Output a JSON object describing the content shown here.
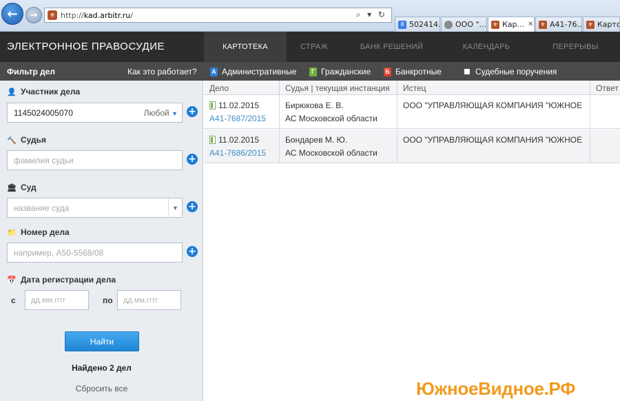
{
  "browser": {
    "url_prefix": "http://",
    "url_host": "kad.arbitr.ru",
    "url_suffix": "/",
    "address_controls": "⌕ ▾ ↻",
    "tabs": [
      {
        "label": "502414...",
        "icon": "google-icon",
        "color": "#3b7de8",
        "active": false,
        "closable": false
      },
      {
        "label": "ООО \"...",
        "icon": "loading-icon",
        "color": "#8a8a8a",
        "active": false,
        "closable": false
      },
      {
        "label": "Кар...",
        "icon": "emblem-icon",
        "color": "#b5522b",
        "active": true,
        "closable": true
      },
      {
        "label": "А41-76...",
        "icon": "emblem-icon",
        "color": "#b5522b",
        "active": false,
        "closable": false
      },
      {
        "label": "Картоте...",
        "icon": "emblem-icon",
        "color": "#b5522b",
        "active": false,
        "closable": false
      }
    ]
  },
  "site": {
    "title": "ЭЛЕКТРОННОЕ ПРАВОСУДИЕ",
    "nav": [
      {
        "label": "КАРТОТЕКА",
        "active": true
      },
      {
        "label": "СТРАЖ",
        "active": false
      },
      {
        "label": "БАНК РЕШЕНИЙ",
        "active": false
      },
      {
        "label": "КАЛЕНДАРЬ",
        "active": false
      },
      {
        "label": "ПЕРЕРЫВЫ",
        "active": false
      }
    ]
  },
  "filter_bar": {
    "title": "Фильтр дел",
    "how_link": "Как это работает?",
    "types": [
      {
        "letter": "А",
        "label": "Административные",
        "color": "#2a7fd4"
      },
      {
        "letter": "Г",
        "label": "Гражданские",
        "color": "#6fb03c"
      },
      {
        "letter": "Б",
        "label": "Банкротные",
        "color": "#d9432f"
      }
    ],
    "court_orders": "Судебные поручения"
  },
  "filters": {
    "participant": {
      "label": "Участник дела",
      "value": "1145024005070",
      "mode": "Любой"
    },
    "judge": {
      "label": "Судья",
      "placeholder": "фамилия судьи"
    },
    "court": {
      "label": "Суд",
      "placeholder": "название суда"
    },
    "case_number": {
      "label": "Номер дела",
      "placeholder": "например, А50-5568/08"
    },
    "reg_date": {
      "label": "Дата регистрации дела",
      "from_label": "с",
      "to_label": "по",
      "from_placeholder": "дд.мм.гггг",
      "to_placeholder": "дд.мм.гггг"
    },
    "find_button": "Найти",
    "found_text": "Найдено 2 дел",
    "reset_text": "Сбросить все"
  },
  "results": {
    "columns": [
      "Дело",
      "Судья | текущая инстанция",
      "Истец",
      "Ответ"
    ],
    "rows": [
      {
        "date": "11.02.2015",
        "case": "А41-7687/2015",
        "judge": "Бирюкова Е. В.",
        "court": "АС Московской области",
        "plaintiff": "ООО \"УПРАВЛЯЮЩАЯ КОМПАНИЯ \"ЮЖНОЕ"
      },
      {
        "date": "11.02.2015",
        "case": "А41-7686/2015",
        "judge": "Бондарев М. Ю.",
        "court": "АС Московской области",
        "plaintiff": "ООО \"УПРАВЛЯЮЩАЯ КОМПАНИЯ \"ЮЖНОЕ"
      }
    ]
  },
  "watermark": "ЮжноеВидное.РФ"
}
